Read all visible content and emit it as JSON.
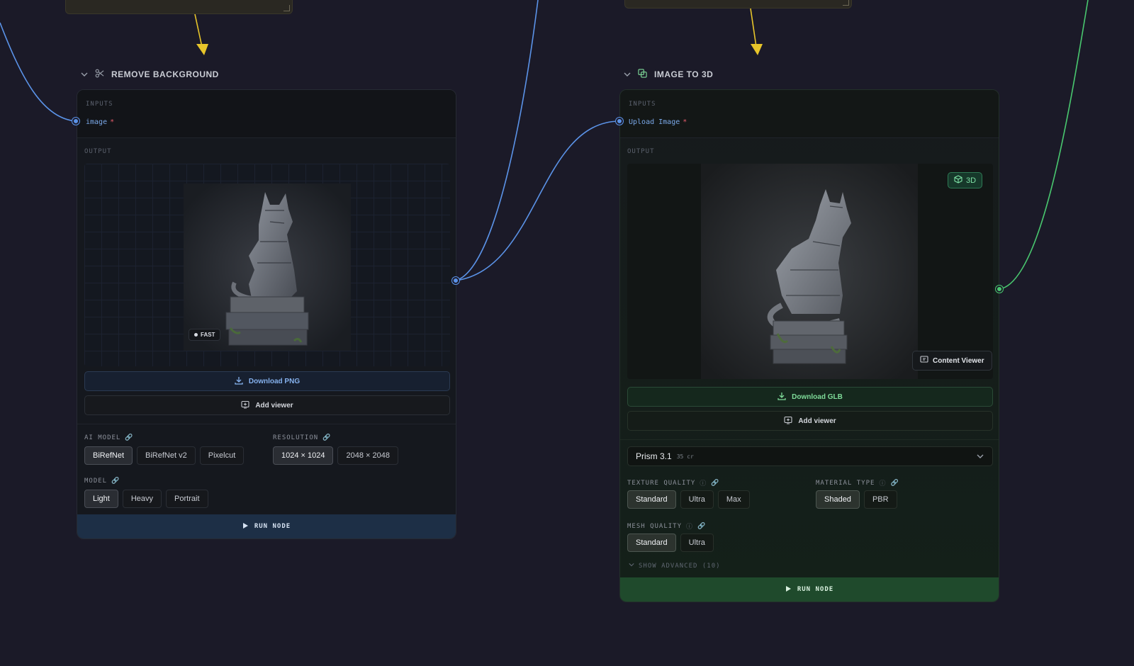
{
  "node_a": {
    "title": "REMOVE BACKGROUND",
    "inputs_label": "INPUTS",
    "input_port": {
      "name": "image",
      "required_mark": "*"
    },
    "output_label": "OUTPUT",
    "badge": "FAST",
    "download_label": "Download PNG",
    "add_viewer_label": "Add viewer",
    "ai_model": {
      "label": "AI MODEL",
      "options": [
        "BiRefNet",
        "BiRefNet v2",
        "Pixelcut"
      ],
      "selected": "BiRefNet"
    },
    "resolution": {
      "label": "RESOLUTION",
      "options": [
        "1024 × 1024",
        "2048 × 2048"
      ],
      "selected": "1024 × 1024"
    },
    "model": {
      "label": "MODEL",
      "options": [
        "Light",
        "Heavy",
        "Portrait"
      ],
      "selected": "Light"
    },
    "run_label": "RUN NODE"
  },
  "node_b": {
    "title": "IMAGE TO 3D",
    "inputs_label": "INPUTS",
    "input_port": {
      "name": "Upload Image",
      "required_mark": "*"
    },
    "output_label": "OUTPUT",
    "badge": "3D",
    "content_viewer_label": "Content Viewer",
    "download_label": "Download GLB",
    "add_viewer_label": "Add viewer",
    "model_select": {
      "value": "Prism 3.1",
      "cost": "35 cr"
    },
    "texture_quality": {
      "label": "TEXTURE QUALITY",
      "options": [
        "Standard",
        "Ultra",
        "Max"
      ],
      "selected": "Standard"
    },
    "material_type": {
      "label": "MATERIAL TYPE",
      "options": [
        "Shaded",
        "PBR"
      ],
      "selected": "Shaded"
    },
    "mesh_quality": {
      "label": "MESH QUALITY",
      "options": [
        "Standard",
        "Ultra"
      ],
      "selected": "Standard"
    },
    "show_advanced": "SHOW ADVANCED (10)",
    "run_label": "RUN NODE"
  },
  "colors": {
    "background": "#1b1a28",
    "wire_blue": "#5b93e8",
    "wire_green": "#49c76f",
    "wire_yellow": "#e7c52a",
    "accent_green": "#7fdc9a",
    "accent_blue": "#86b2ee",
    "required": "#e35b6a"
  },
  "icons": {
    "remove_bg": "scissors-icon",
    "image_to_3d": "layers-icon",
    "download": "download-icon",
    "viewer": "monitor-plus-icon",
    "cube": "cube-icon",
    "play": "play-icon",
    "link": "link-icon",
    "info": "info-icon"
  }
}
